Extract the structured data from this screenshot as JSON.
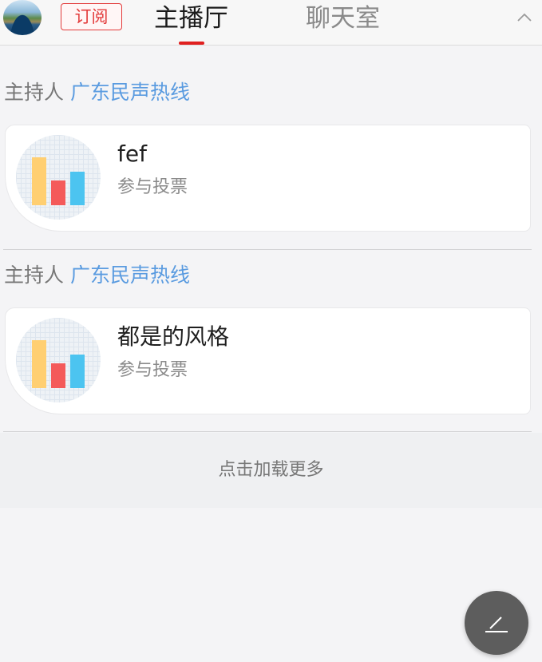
{
  "header": {
    "subscribe_label": "订阅",
    "tabs": [
      {
        "label": "主播厅",
        "active": true
      },
      {
        "label": "聊天室",
        "active": false
      }
    ],
    "collapse_icon": "chevron-up-icon",
    "accent_color": "#e02020"
  },
  "posts": [
    {
      "host_prefix": "主持人",
      "host_name": "广东民声热线",
      "title": "fef",
      "subtitle": "参与投票",
      "thumb_icon": "bar-chart-icon"
    },
    {
      "host_prefix": "主持人",
      "host_name": "广东民声热线",
      "title": "都是的风格",
      "subtitle": "参与投票",
      "thumb_icon": "bar-chart-icon"
    }
  ],
  "load_more_label": "点击加载更多",
  "fab_icon": "edit-pen-icon",
  "colors": {
    "host_name": "#5a9be0",
    "bar_yellow": "#ffcf72",
    "bar_red": "#f45a5a",
    "bar_blue": "#4cc4f0"
  }
}
